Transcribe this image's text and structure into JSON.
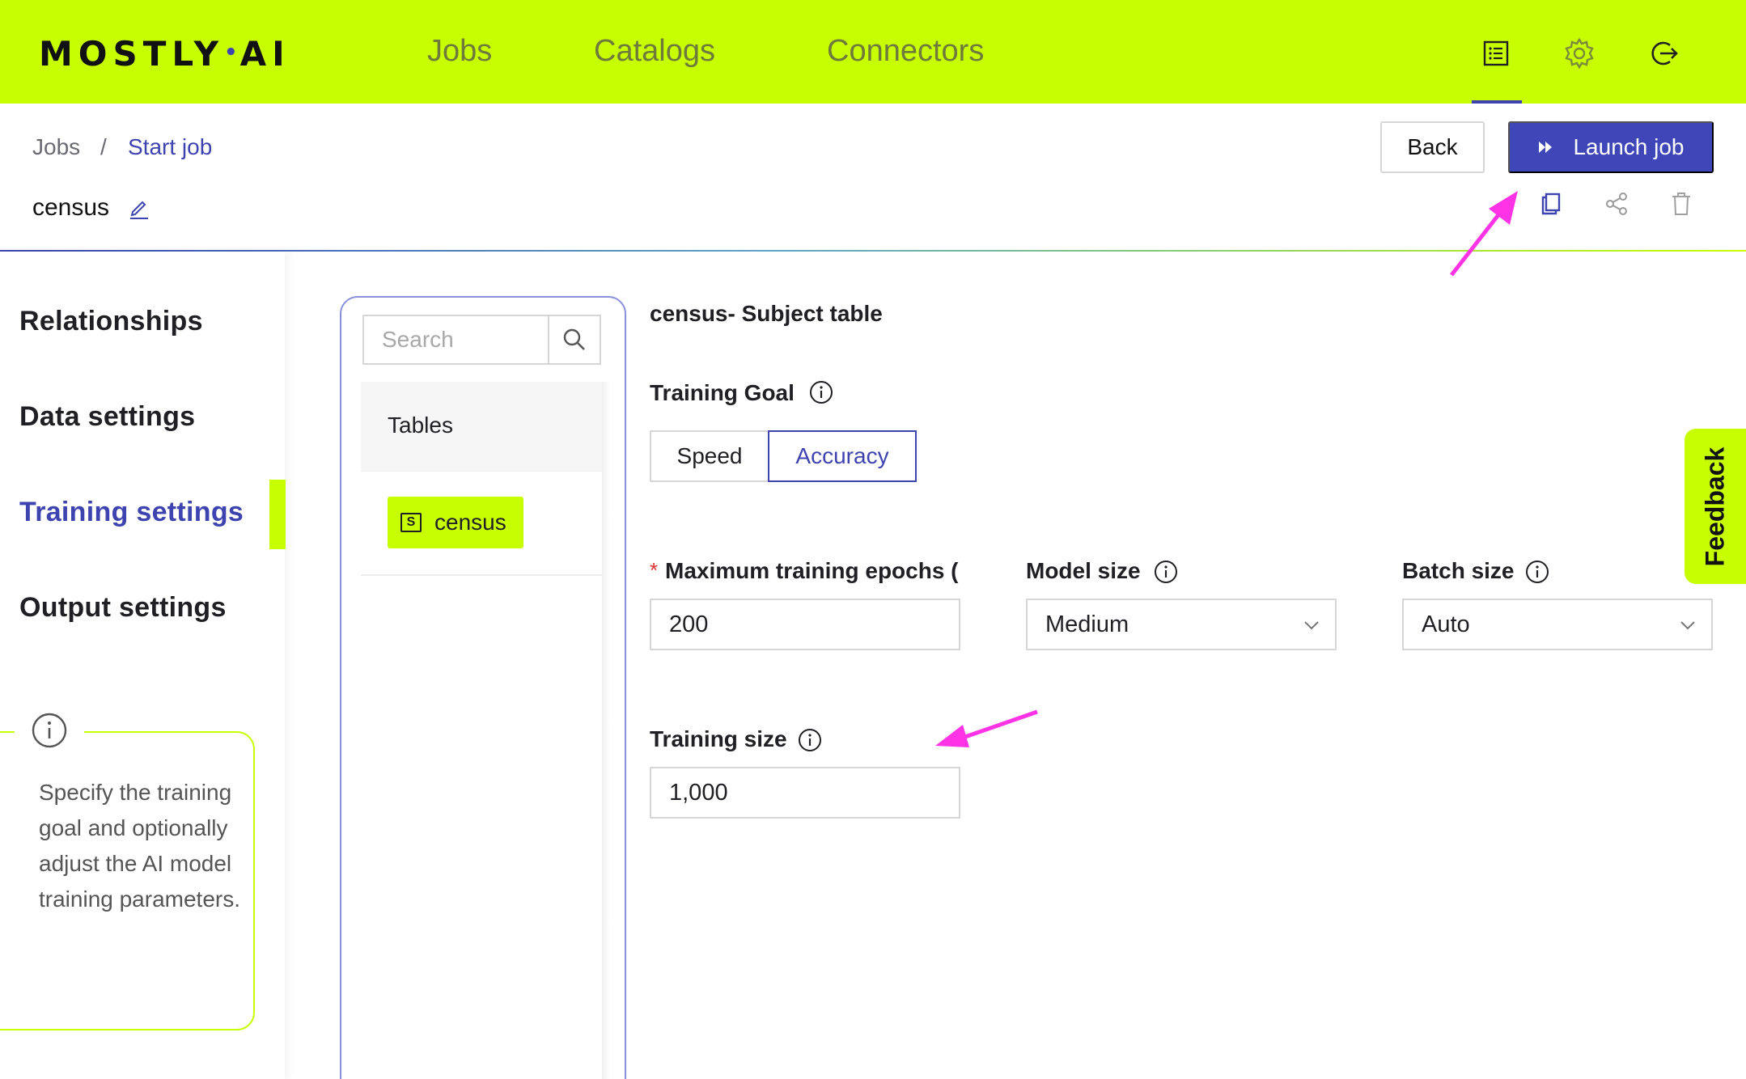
{
  "brand": {
    "logo_left": "MOSTLY",
    "logo_dot": "•",
    "logo_right": "AI"
  },
  "nav": {
    "jobs": "Jobs",
    "catalogs": "Catalogs",
    "connectors": "Connectors"
  },
  "header_icons": [
    "list-icon",
    "gear-icon",
    "logout-icon"
  ],
  "breadcrumb": {
    "root": "Jobs",
    "separator": "/",
    "current": "Start job"
  },
  "job": {
    "name": "census"
  },
  "actions": {
    "back": "Back",
    "launch": "Launch job",
    "icons": [
      "copy-icon",
      "share-icon",
      "trash-icon"
    ]
  },
  "sidebar": {
    "items": [
      "Relationships",
      "Data settings",
      "Training settings",
      "Output settings"
    ],
    "active": "Training settings",
    "info": "Specify the training goal and optionally adjust the AI model training parameters."
  },
  "tables_panel": {
    "search_placeholder": "Search",
    "header": "Tables",
    "table": {
      "badge": "S",
      "name": "census"
    }
  },
  "form": {
    "title": "census- Subject table",
    "training_goal": {
      "label": "Training Goal",
      "options": [
        "Speed",
        "Accuracy"
      ],
      "selected": "Accuracy"
    },
    "max_epochs": {
      "required": "*",
      "label": "Maximum training epochs (",
      "value": "200"
    },
    "model_size": {
      "label": "Model size",
      "value": "Medium"
    },
    "batch_size": {
      "label": "Batch size",
      "value": "Auto"
    },
    "training_size": {
      "label": "Training size",
      "value": "1,000"
    }
  },
  "feedback": "Feedback",
  "colors": {
    "accent": "#c8ff00",
    "primary": "#3d44b0",
    "annotation": "#ff33e6"
  }
}
